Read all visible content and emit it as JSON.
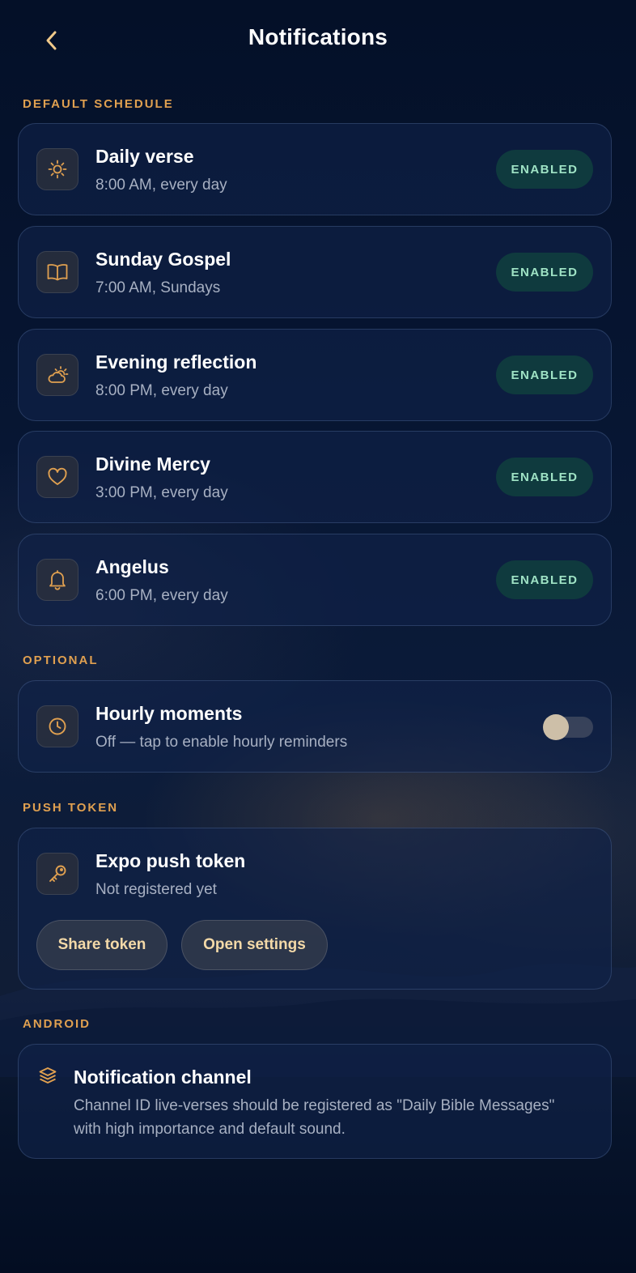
{
  "header": {
    "title": "Notifications",
    "back_icon": "chevron-left-icon"
  },
  "colors": {
    "accent": "#e0a050",
    "badge_bg": "#0f3a3e",
    "badge_text": "#9fe3c5",
    "background": "#071633"
  },
  "sections": {
    "default_schedule": {
      "label": "DEFAULT SCHEDULE",
      "items": [
        {
          "title": "Daily verse",
          "subtitle": "8:00 AM, every day",
          "status": "ENABLED",
          "icon": "sun-icon"
        },
        {
          "title": "Sunday Gospel",
          "subtitle": "7:00 AM, Sundays",
          "status": "ENABLED",
          "icon": "book-icon"
        },
        {
          "title": "Evening reflection",
          "subtitle": "8:00 PM, every day",
          "status": "ENABLED",
          "icon": "cloud-sun-icon"
        },
        {
          "title": "Divine Mercy",
          "subtitle": "3:00 PM, every day",
          "status": "ENABLED",
          "icon": "heart-icon"
        },
        {
          "title": "Angelus",
          "subtitle": "6:00 PM, every day",
          "status": "ENABLED",
          "icon": "bell-icon"
        }
      ]
    },
    "optional": {
      "label": "OPTIONAL",
      "items": [
        {
          "title": "Hourly moments",
          "subtitle": "Off — tap to enable hourly reminders",
          "toggle_on": false,
          "icon": "clock-icon"
        }
      ]
    },
    "push_token": {
      "label": "PUSH TOKEN",
      "title": "Expo push token",
      "subtitle": "Not registered yet",
      "icon": "key-icon",
      "share_button": "Share token",
      "settings_button": "Open settings"
    },
    "android": {
      "label": "ANDROID",
      "title": "Notification channel",
      "description": "Channel ID live-verses should be registered as \"Daily Bible Messages\" with high importance and default sound.",
      "icon": "layers-icon"
    }
  }
}
